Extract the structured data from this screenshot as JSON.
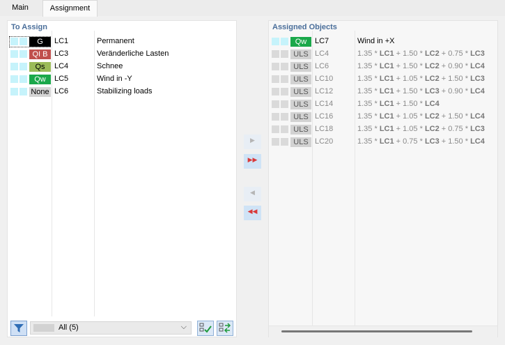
{
  "tabs": [
    {
      "label": "Main",
      "active": false
    },
    {
      "label": "Assignment",
      "active": true
    }
  ],
  "to_assign": {
    "title": "To Assign",
    "rows": [
      {
        "badge": "G",
        "badge_bg": "#000000",
        "badge_fg": "#ffffff",
        "lc": "LC1",
        "desc": "Permanent"
      },
      {
        "badge": "QI B",
        "badge_bg": "#c0504d",
        "badge_fg": "#ffffff",
        "lc": "LC3",
        "desc": "Veränderliche Lasten"
      },
      {
        "badge": "Qs",
        "badge_bg": "#9bbb59",
        "badge_fg": "#000000",
        "lc": "LC4",
        "desc": "Schnee"
      },
      {
        "badge": "Qw",
        "badge_bg": "#1aa84a",
        "badge_fg": "#ffffff",
        "lc": "LC5",
        "desc": "Wind in -Y"
      },
      {
        "badge": "None",
        "badge_bg": "#d4d4d4",
        "badge_fg": "#000000",
        "lc": "LC6",
        "desc": "Stabilizing loads"
      }
    ],
    "filter_select": "All (5)"
  },
  "assigned": {
    "title": "Assigned Objects",
    "rows": [
      {
        "badge": "Qw",
        "lc": "LC7",
        "desc": "Wind in +X",
        "parts": null
      },
      {
        "badge": "ULS",
        "lc": "LC4",
        "parts": [
          "1.35 * ",
          "LC1",
          " + 1.50 * ",
          "LC2",
          " + 0.75 * ",
          "LC3"
        ]
      },
      {
        "badge": "ULS",
        "lc": "LC6",
        "parts": [
          "1.35 * ",
          "LC1",
          " + 1.50 * ",
          "LC2",
          " + 0.90 * ",
          "LC4"
        ]
      },
      {
        "badge": "ULS",
        "lc": "LC10",
        "parts": [
          "1.35 * ",
          "LC1",
          " + 1.05 * ",
          "LC2",
          " + 1.50 * ",
          "LC3"
        ]
      },
      {
        "badge": "ULS",
        "lc": "LC12",
        "parts": [
          "1.35 * ",
          "LC1",
          " + 1.50 * ",
          "LC3",
          " + 0.90 * ",
          "LC4"
        ]
      },
      {
        "badge": "ULS",
        "lc": "LC14",
        "parts": [
          "1.35 * ",
          "LC1",
          " + 1.50 * ",
          "LC4"
        ]
      },
      {
        "badge": "ULS",
        "lc": "LC16",
        "parts": [
          "1.35 * ",
          "LC1",
          " + 1.05 * ",
          "LC2",
          " + 1.50 * ",
          "LC4"
        ]
      },
      {
        "badge": "ULS",
        "lc": "LC18",
        "parts": [
          "1.35 * ",
          "LC1",
          " + 1.05 * ",
          "LC2",
          " + 0.75 * ",
          "LC3"
        ]
      },
      {
        "badge": "ULS",
        "lc": "LC20",
        "parts": [
          "1.35 * ",
          "LC1",
          " + 0.75 * ",
          "LC3",
          " + 1.50 * ",
          "LC4"
        ]
      }
    ]
  },
  "buttons": {
    "assign_one": "▶",
    "assign_all": "▶▶",
    "remove_one": "◀",
    "remove_all": "◀◀"
  },
  "colors": {
    "title": "#4a6e9a",
    "qw_badge": "#1aa84a",
    "uls_badge": "#d2d2d2",
    "arrow_red": "#d93a3a"
  }
}
